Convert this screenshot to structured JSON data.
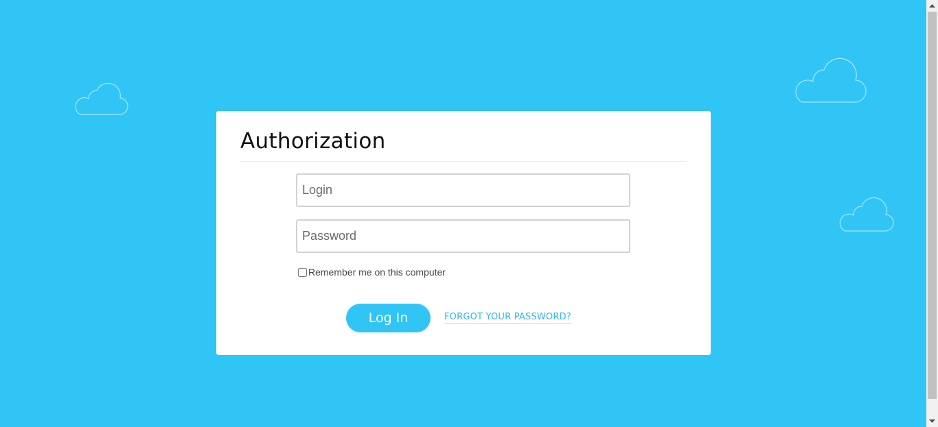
{
  "page": {
    "background_color": "#31c5f6"
  },
  "auth": {
    "title": "Authorization",
    "login_placeholder": "Login",
    "password_placeholder": "Password",
    "remember_label": "Remember me on this computer",
    "remember_checked": false,
    "login_button_label": "Log In",
    "forgot_password_label": "FORGOT YOUR PASSWORD?"
  },
  "colors": {
    "accent": "#31c5f6",
    "link": "#31b6ea",
    "card": "#ffffff"
  },
  "icons": {
    "decorations": [
      "cloud-icon",
      "cloud-icon",
      "cloud-icon"
    ],
    "scroll_up": "chevron-up-icon",
    "scroll_down": "chevron-down-icon"
  }
}
